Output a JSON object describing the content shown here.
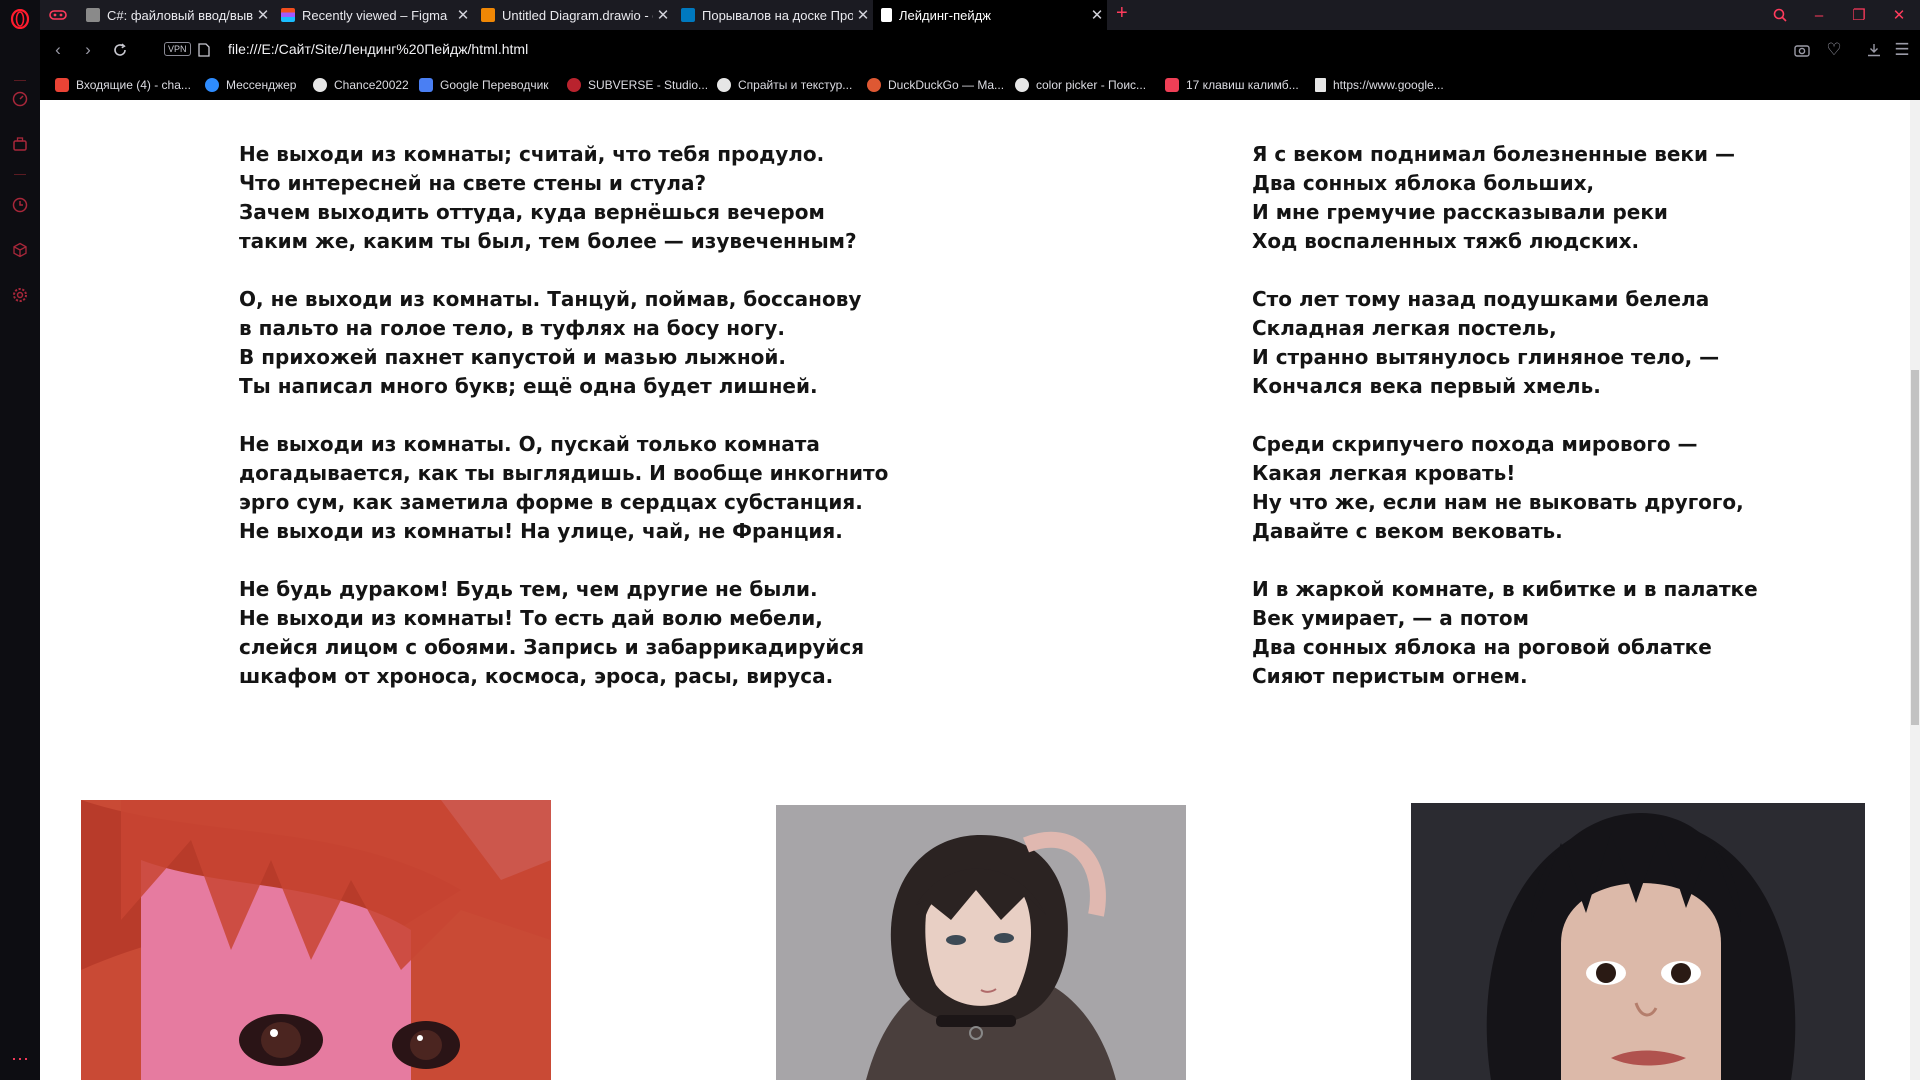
{
  "tabs": [
    {
      "title": "C#: файловый ввод/вывод",
      "active": false
    },
    {
      "title": "Recently viewed – Figma",
      "active": false
    },
    {
      "title": "Untitled Diagram.drawio - draw.io",
      "active": false
    },
    {
      "title": "Порывалов на доске Проекты",
      "active": false
    },
    {
      "title": "Лейдинг-пейдж",
      "active": true
    }
  ],
  "address": {
    "vpn_label": "VPN",
    "url": "file:///E:/Сайт/Site/Лендинг%20Пейдж/html.html"
  },
  "bookmarks": [
    {
      "label": "Входящие (4) - cha...",
      "icon": "gmail-icon",
      "color": "#ea4335"
    },
    {
      "label": "Мессенджер",
      "icon": "messenger-icon",
      "color": "#2e8cff"
    },
    {
      "label": "Chance20022",
      "icon": "github-icon",
      "color": "#e6e6e6"
    },
    {
      "label": "Google Переводчик",
      "icon": "translate-icon",
      "color": "#4a7ff3"
    },
    {
      "label": "SUBVERSE - Studio...",
      "icon": "subverse-icon",
      "color": "#b9232e"
    },
    {
      "label": "Спрайты и текстур...",
      "icon": "r-icon",
      "color": "#e6e6e6"
    },
    {
      "label": "DuckDuckGo — Ma...",
      "icon": "duckduckgo-icon",
      "color": "#de5833"
    },
    {
      "label": "color picker - Поис...",
      "icon": "google-icon",
      "color": "#e6e6e6"
    },
    {
      "label": "17 клавиш калимб...",
      "icon": "pocket-icon",
      "color": "#ef3f56"
    },
    {
      "label": "https://www.google...",
      "icon": "file-icon",
      "color": "#e6e6e6"
    }
  ],
  "poem_left": [
    [
      "Не выходи из комнаты; считай, что тебя продуло.",
      "Что интересней на свете стены и стула?",
      "Зачем выходить оттуда, куда вернёшься вечером",
      "таким же, каким ты был, тем более — изувеченным?"
    ],
    [
      "О, не выходи из комнаты. Танцуй, поймав, боссанову",
      "в пальто на голое тело, в туфлях на босу ногу.",
      "В прихожей пахнет капустой и мазью лыжной.",
      "Ты написал много букв; ещё одна будет лишней."
    ],
    [
      "Не выходи из комнаты. О, пускай только комната",
      "догадывается, как ты выглядишь. И вообще инкогнито",
      "эрго сум, как заметила форме в сердцах субстанция.",
      "Не выходи из комнаты! На улице, чай, не Франция."
    ],
    [
      "Не будь дураком! Будь тем, чем другие не были.",
      "Не выходи из комнаты! То есть дай волю мебели,",
      "слейся лицом с обоями. Запрись и забаррикадируйся",
      "шкафом от хроноса, космоса, эроса, расы, вируса."
    ]
  ],
  "poem_right": [
    [
      "Я с веком поднимал болезненные веки —",
      "Два сонных яблока больших,",
      "И мне гремучие рассказывали реки",
      "Ход воспаленных тяжб людских."
    ],
    [
      "Сто лет тому назад подушками белела",
      "Складная легкая постель,",
      "И странно вытянулось глиняное тело, —",
      "Кончался века первый хмель."
    ],
    [
      "Среди скрипучего похода мирового —",
      "Какая легкая кровать!",
      "Ну что же, если нам не выковать другого,",
      "Давайте с веком вековать."
    ],
    [
      "И в жаркой комнате, в кибитке и в палатке",
      "Век умирает, — а потом",
      "Два сонных яблока на роговой облатке",
      "Сияют перистым огнем."
    ]
  ],
  "colors": {
    "accent": "#ff3b5c",
    "page_bg": "#ffffff",
    "text": "#141414"
  }
}
